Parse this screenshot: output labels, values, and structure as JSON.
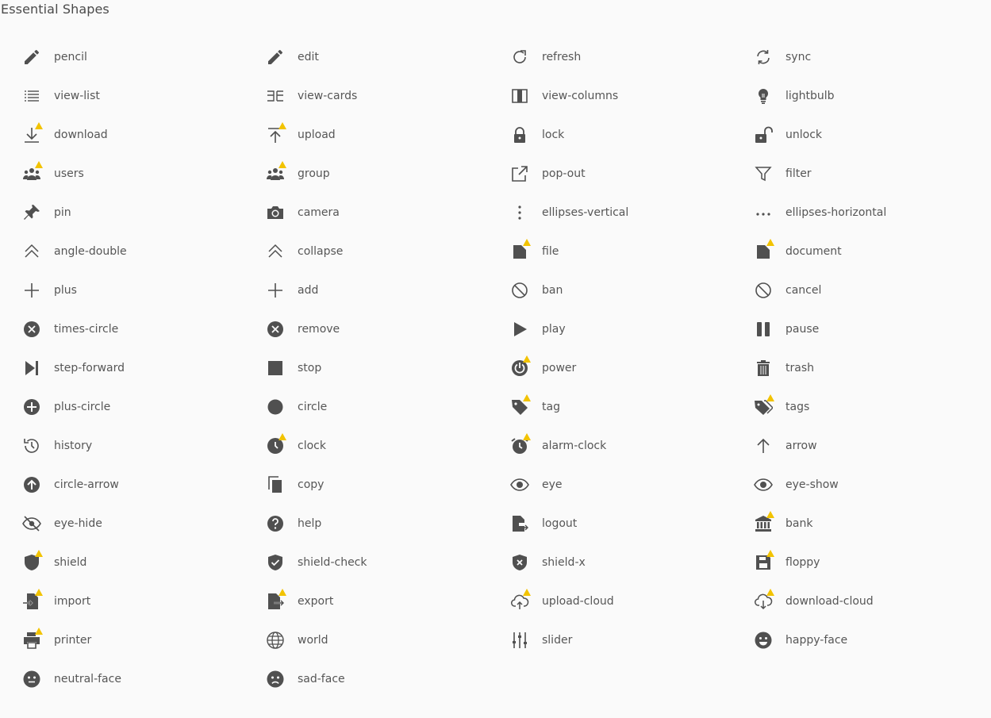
{
  "page": {
    "title": "Essential Shapes"
  },
  "colors": {
    "icon": "#505050",
    "badge": "#f2c300",
    "text": "#565656",
    "background": "#fafafa"
  },
  "icons": [
    {
      "label": "pencil",
      "icon": "pencil",
      "badge": false
    },
    {
      "label": "edit",
      "icon": "pencil",
      "badge": false
    },
    {
      "label": "refresh",
      "icon": "refresh",
      "badge": false
    },
    {
      "label": "sync",
      "icon": "sync",
      "badge": false
    },
    {
      "label": "view-list",
      "icon": "view-list",
      "badge": false
    },
    {
      "label": "view-cards",
      "icon": "view-cards",
      "badge": false
    },
    {
      "label": "view-columns",
      "icon": "view-columns",
      "badge": false
    },
    {
      "label": "lightbulb",
      "icon": "lightbulb",
      "badge": false
    },
    {
      "label": "download",
      "icon": "download",
      "badge": true
    },
    {
      "label": "upload",
      "icon": "upload",
      "badge": true
    },
    {
      "label": "lock",
      "icon": "lock",
      "badge": false
    },
    {
      "label": "unlock",
      "icon": "unlock",
      "badge": false
    },
    {
      "label": "users",
      "icon": "users",
      "badge": true
    },
    {
      "label": "group",
      "icon": "users",
      "badge": true
    },
    {
      "label": "pop-out",
      "icon": "pop-out",
      "badge": false
    },
    {
      "label": "filter",
      "icon": "filter",
      "badge": false
    },
    {
      "label": "pin",
      "icon": "pin",
      "badge": false
    },
    {
      "label": "camera",
      "icon": "camera",
      "badge": false
    },
    {
      "label": "ellipses-vertical",
      "icon": "ellipses-vertical",
      "badge": false
    },
    {
      "label": "ellipses-horizontal",
      "icon": "ellipses-horizontal",
      "badge": false
    },
    {
      "label": "angle-double",
      "icon": "angle-double",
      "badge": false
    },
    {
      "label": "collapse",
      "icon": "angle-double",
      "badge": false
    },
    {
      "label": "file",
      "icon": "file",
      "badge": true
    },
    {
      "label": "document",
      "icon": "file",
      "badge": true
    },
    {
      "label": "plus",
      "icon": "plus",
      "badge": false
    },
    {
      "label": "add",
      "icon": "plus",
      "badge": false
    },
    {
      "label": "ban",
      "icon": "ban",
      "badge": false
    },
    {
      "label": "cancel",
      "icon": "ban",
      "badge": false
    },
    {
      "label": "times-circle",
      "icon": "times-circle",
      "badge": false
    },
    {
      "label": "remove",
      "icon": "times-circle",
      "badge": false
    },
    {
      "label": "play",
      "icon": "play",
      "badge": false
    },
    {
      "label": "pause",
      "icon": "pause",
      "badge": false
    },
    {
      "label": "step-forward",
      "icon": "step-forward",
      "badge": false
    },
    {
      "label": "stop",
      "icon": "stop",
      "badge": false
    },
    {
      "label": "power",
      "icon": "power",
      "badge": true
    },
    {
      "label": "trash",
      "icon": "trash",
      "badge": false
    },
    {
      "label": "plus-circle",
      "icon": "plus-circle",
      "badge": false
    },
    {
      "label": "circle",
      "icon": "circle",
      "badge": false
    },
    {
      "label": "tag",
      "icon": "tag",
      "badge": true
    },
    {
      "label": "tags",
      "icon": "tags",
      "badge": true
    },
    {
      "label": "history",
      "icon": "history",
      "badge": false
    },
    {
      "label": "clock",
      "icon": "clock",
      "badge": true
    },
    {
      "label": "alarm-clock",
      "icon": "alarm-clock",
      "badge": true
    },
    {
      "label": "arrow",
      "icon": "arrow",
      "badge": false
    },
    {
      "label": "circle-arrow",
      "icon": "circle-arrow",
      "badge": false
    },
    {
      "label": "copy",
      "icon": "copy",
      "badge": false
    },
    {
      "label": "eye",
      "icon": "eye",
      "badge": false
    },
    {
      "label": "eye-show",
      "icon": "eye",
      "badge": false
    },
    {
      "label": "eye-hide",
      "icon": "eye-hide",
      "badge": false
    },
    {
      "label": "help",
      "icon": "help",
      "badge": false
    },
    {
      "label": "logout",
      "icon": "logout",
      "badge": false
    },
    {
      "label": "bank",
      "icon": "bank",
      "badge": true
    },
    {
      "label": "shield",
      "icon": "shield",
      "badge": true
    },
    {
      "label": "shield-check",
      "icon": "shield-check",
      "badge": false
    },
    {
      "label": "shield-x",
      "icon": "shield-x",
      "badge": false
    },
    {
      "label": "floppy",
      "icon": "floppy",
      "badge": true
    },
    {
      "label": "import",
      "icon": "import",
      "badge": true
    },
    {
      "label": "export",
      "icon": "export",
      "badge": true
    },
    {
      "label": "upload-cloud",
      "icon": "upload-cloud",
      "badge": true
    },
    {
      "label": "download-cloud",
      "icon": "download-cloud",
      "badge": true
    },
    {
      "label": "printer",
      "icon": "printer",
      "badge": true
    },
    {
      "label": "world",
      "icon": "world",
      "badge": false
    },
    {
      "label": "slider",
      "icon": "slider",
      "badge": false
    },
    {
      "label": "happy-face",
      "icon": "happy-face",
      "badge": false
    },
    {
      "label": "neutral-face",
      "icon": "neutral-face",
      "badge": false
    },
    {
      "label": "sad-face",
      "icon": "sad-face",
      "badge": false
    }
  ]
}
